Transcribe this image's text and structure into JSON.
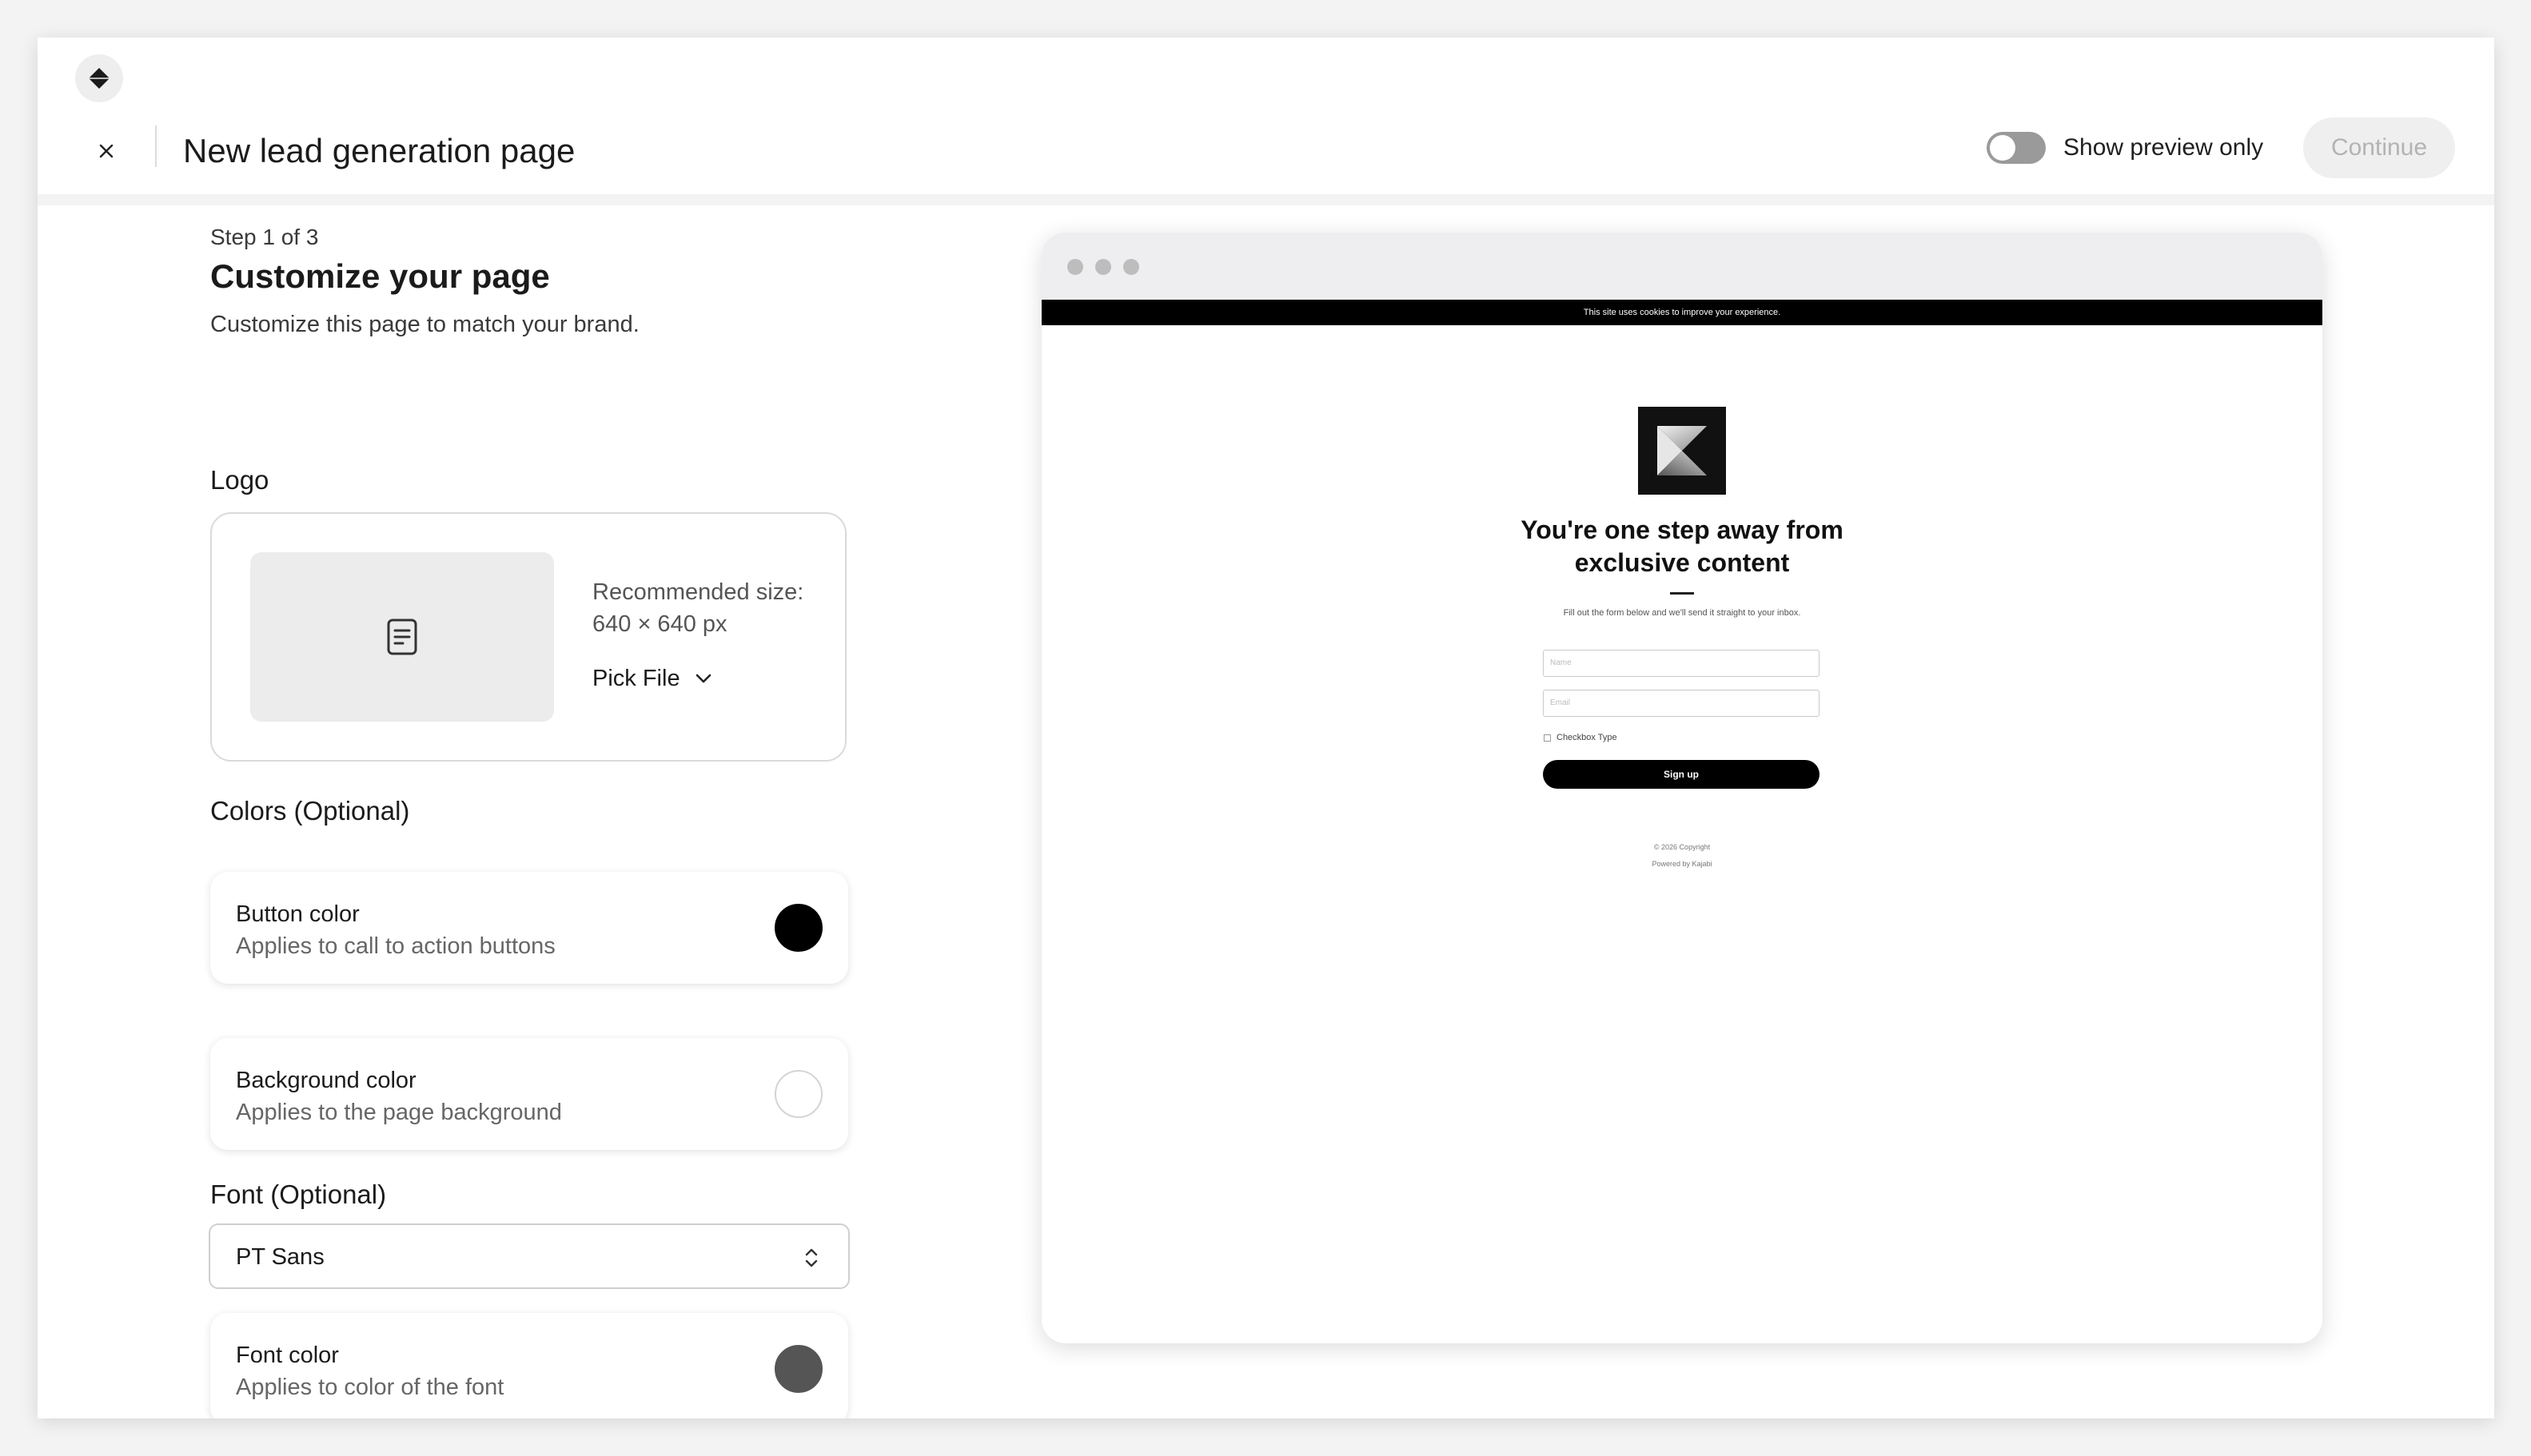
{
  "header": {
    "title": "New lead generation page",
    "preview_toggle_label": "Show preview only",
    "continue_label": "Continue"
  },
  "form": {
    "step": "Step 1 of 3",
    "title": "Customize your page",
    "subtitle": "Customize this page to match your brand.",
    "logo": {
      "label": "Logo",
      "recommended": "Recommended size: 640 × 640 px",
      "pick_file": "Pick File"
    },
    "colors": {
      "label": "Colors (Optional)",
      "button": {
        "title": "Button color",
        "desc": "Applies to call to action buttons",
        "value": "#000000"
      },
      "background": {
        "title": "Background color",
        "desc": "Applies to the page background",
        "value": "#ffffff"
      }
    },
    "font": {
      "label": "Font (Optional)",
      "selected": "PT Sans",
      "color": {
        "title": "Font color",
        "desc": "Applies to color of the font",
        "value": "#555555"
      }
    }
  },
  "preview": {
    "cookie_text": "This site uses cookies to improve your experience.",
    "headline": "You're one step away from exclusive content",
    "subtext": "Fill out the form below and we'll send it straight to your inbox.",
    "name_placeholder": "Name",
    "email_placeholder": "Email",
    "checkbox_label": "Checkbox Type",
    "button_label": "Sign up",
    "copyright": "© 2026 Copyright",
    "powered_by": "Powered by Kajabi"
  },
  "icons": {
    "brand": "diamond-icon",
    "close": "close-icon",
    "logo_placeholder": "document-icon",
    "pick_file": "chevron-down-icon",
    "font_select": "chevron-up-down-icon"
  }
}
